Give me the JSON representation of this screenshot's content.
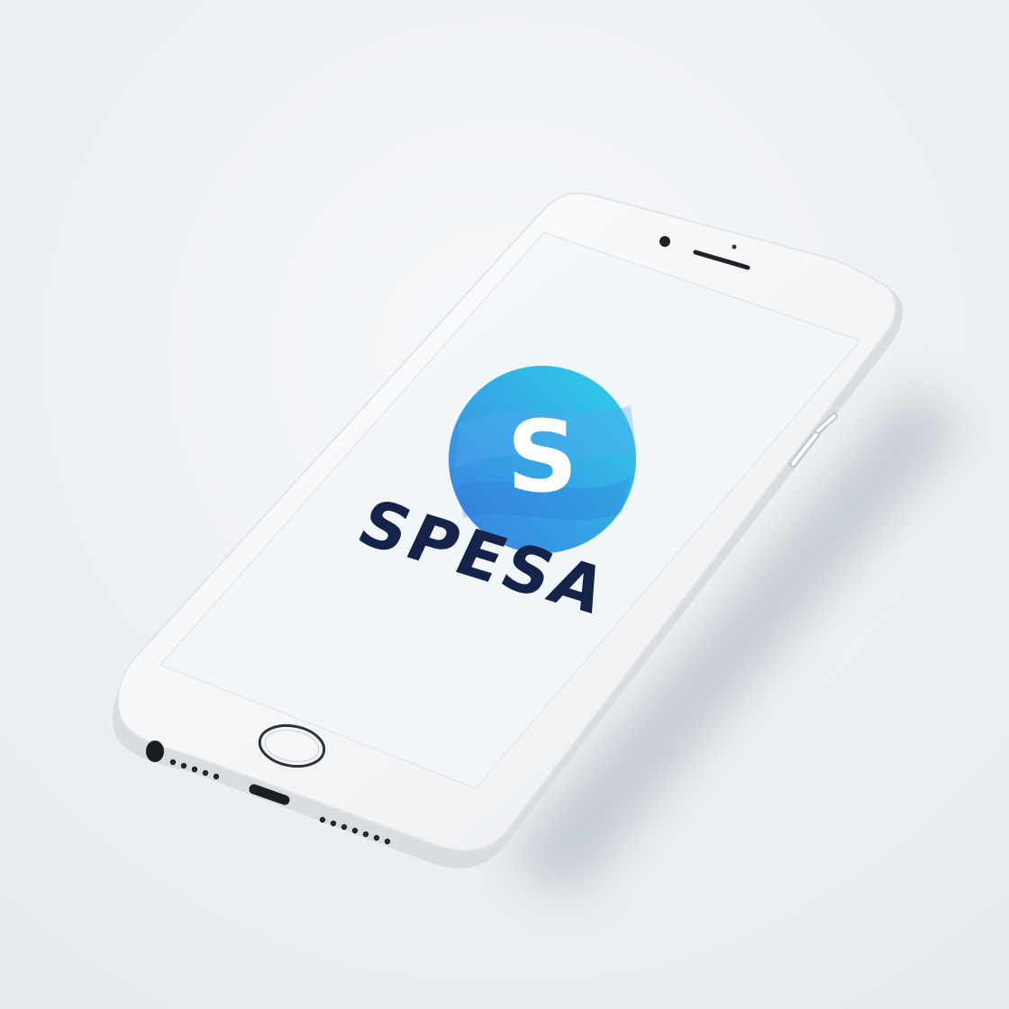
{
  "scene": {
    "background_color": "#eef1f4",
    "phone_body_color": "#f7f8f9",
    "phone_edge_color": "#d9dde2",
    "screen_color": "#f1f6f9"
  },
  "screen": {
    "app_name": "SPESA",
    "logo": {
      "icon": "spesa-logo-icon",
      "letter": "S",
      "gradient_start": "#3b7fe0",
      "gradient_end": "#2fd0ea",
      "wordmark_color": "#13234a"
    }
  },
  "hardware": {
    "front_camera_icon": "camera-dot-icon",
    "earpiece_icon": "speaker-grille-icon",
    "home_button_icon": "home-button-icon",
    "headphone_jack_icon": "headphone-jack-icon",
    "charging_port_icon": "lightning-port-icon",
    "volume_buttons_icon": "volume-buttons-icon"
  }
}
